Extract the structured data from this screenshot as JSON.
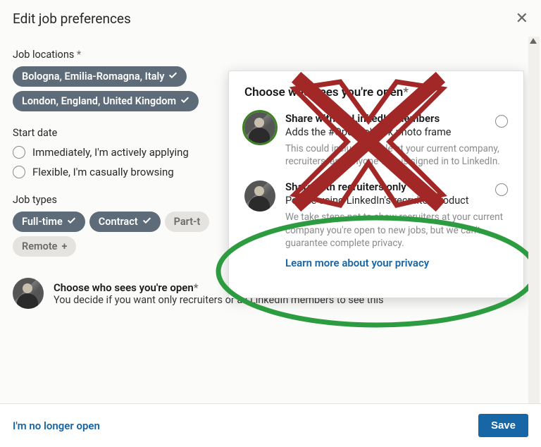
{
  "header": {
    "title": "Edit job preferences"
  },
  "locations": {
    "label": "Job locations",
    "req": "*",
    "items": [
      "Bologna, Emilia-Romagna, Italy",
      "London, England, United Kingdom"
    ]
  },
  "startdate": {
    "label": "Start date",
    "opt1": "Immediately, I'm actively applying",
    "opt2": "Flexible, I'm casually browsing"
  },
  "jobtypes": {
    "label": "Job types",
    "items": [
      {
        "t": "Full-time",
        "on": true
      },
      {
        "t": "Contract",
        "on": true
      },
      {
        "t": "Part-time",
        "on": false,
        "trunc": "Part-t"
      },
      {
        "t": "Remote",
        "add": true
      }
    ]
  },
  "popup": {
    "title": "Choose who sees you're open",
    "req": "*",
    "opt1": {
      "title": "Share with all LinkedIn members",
      "sub": "Adds the #OpenToWork photo frame",
      "note": "This could include people at your current company, recruiters, and anyone who is signed in to LinkedIn."
    },
    "opt2": {
      "title": "Share with recruiters only",
      "sub": "People using LinkedIn's recruiter product",
      "note": "We take steps not to show recruiters at your current company you're open to new jobs, but we can't guarantee complete privacy."
    },
    "link": "Learn more about your privacy"
  },
  "row": {
    "title": "Choose who sees you're open",
    "req": "*",
    "sub": "You decide if you want only recruiters or all LinkedIn members to see this"
  },
  "footer": {
    "nolonger": "I'm no longer open",
    "save": "Save"
  },
  "annotation": {
    "cross": "#a22828",
    "circle": "#2d9b3f"
  }
}
